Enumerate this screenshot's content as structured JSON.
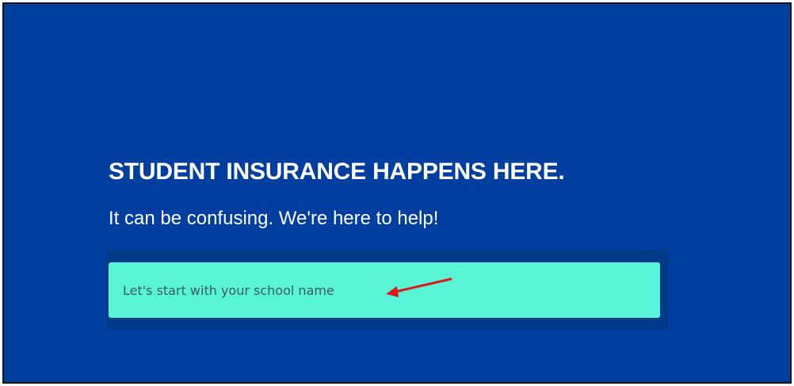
{
  "hero": {
    "headline": "STUDENT INSURANCE HAPPENS HERE.",
    "subheadline": "It can be confusing. We're here to help!"
  },
  "search": {
    "placeholder": "Let's start with your school name",
    "value": ""
  },
  "colors": {
    "background": "#003e9f",
    "input_background": "#57f5d6",
    "annotation_arrow": "#e0161b"
  },
  "icons": {
    "annotation": "red-arrow-icon"
  }
}
